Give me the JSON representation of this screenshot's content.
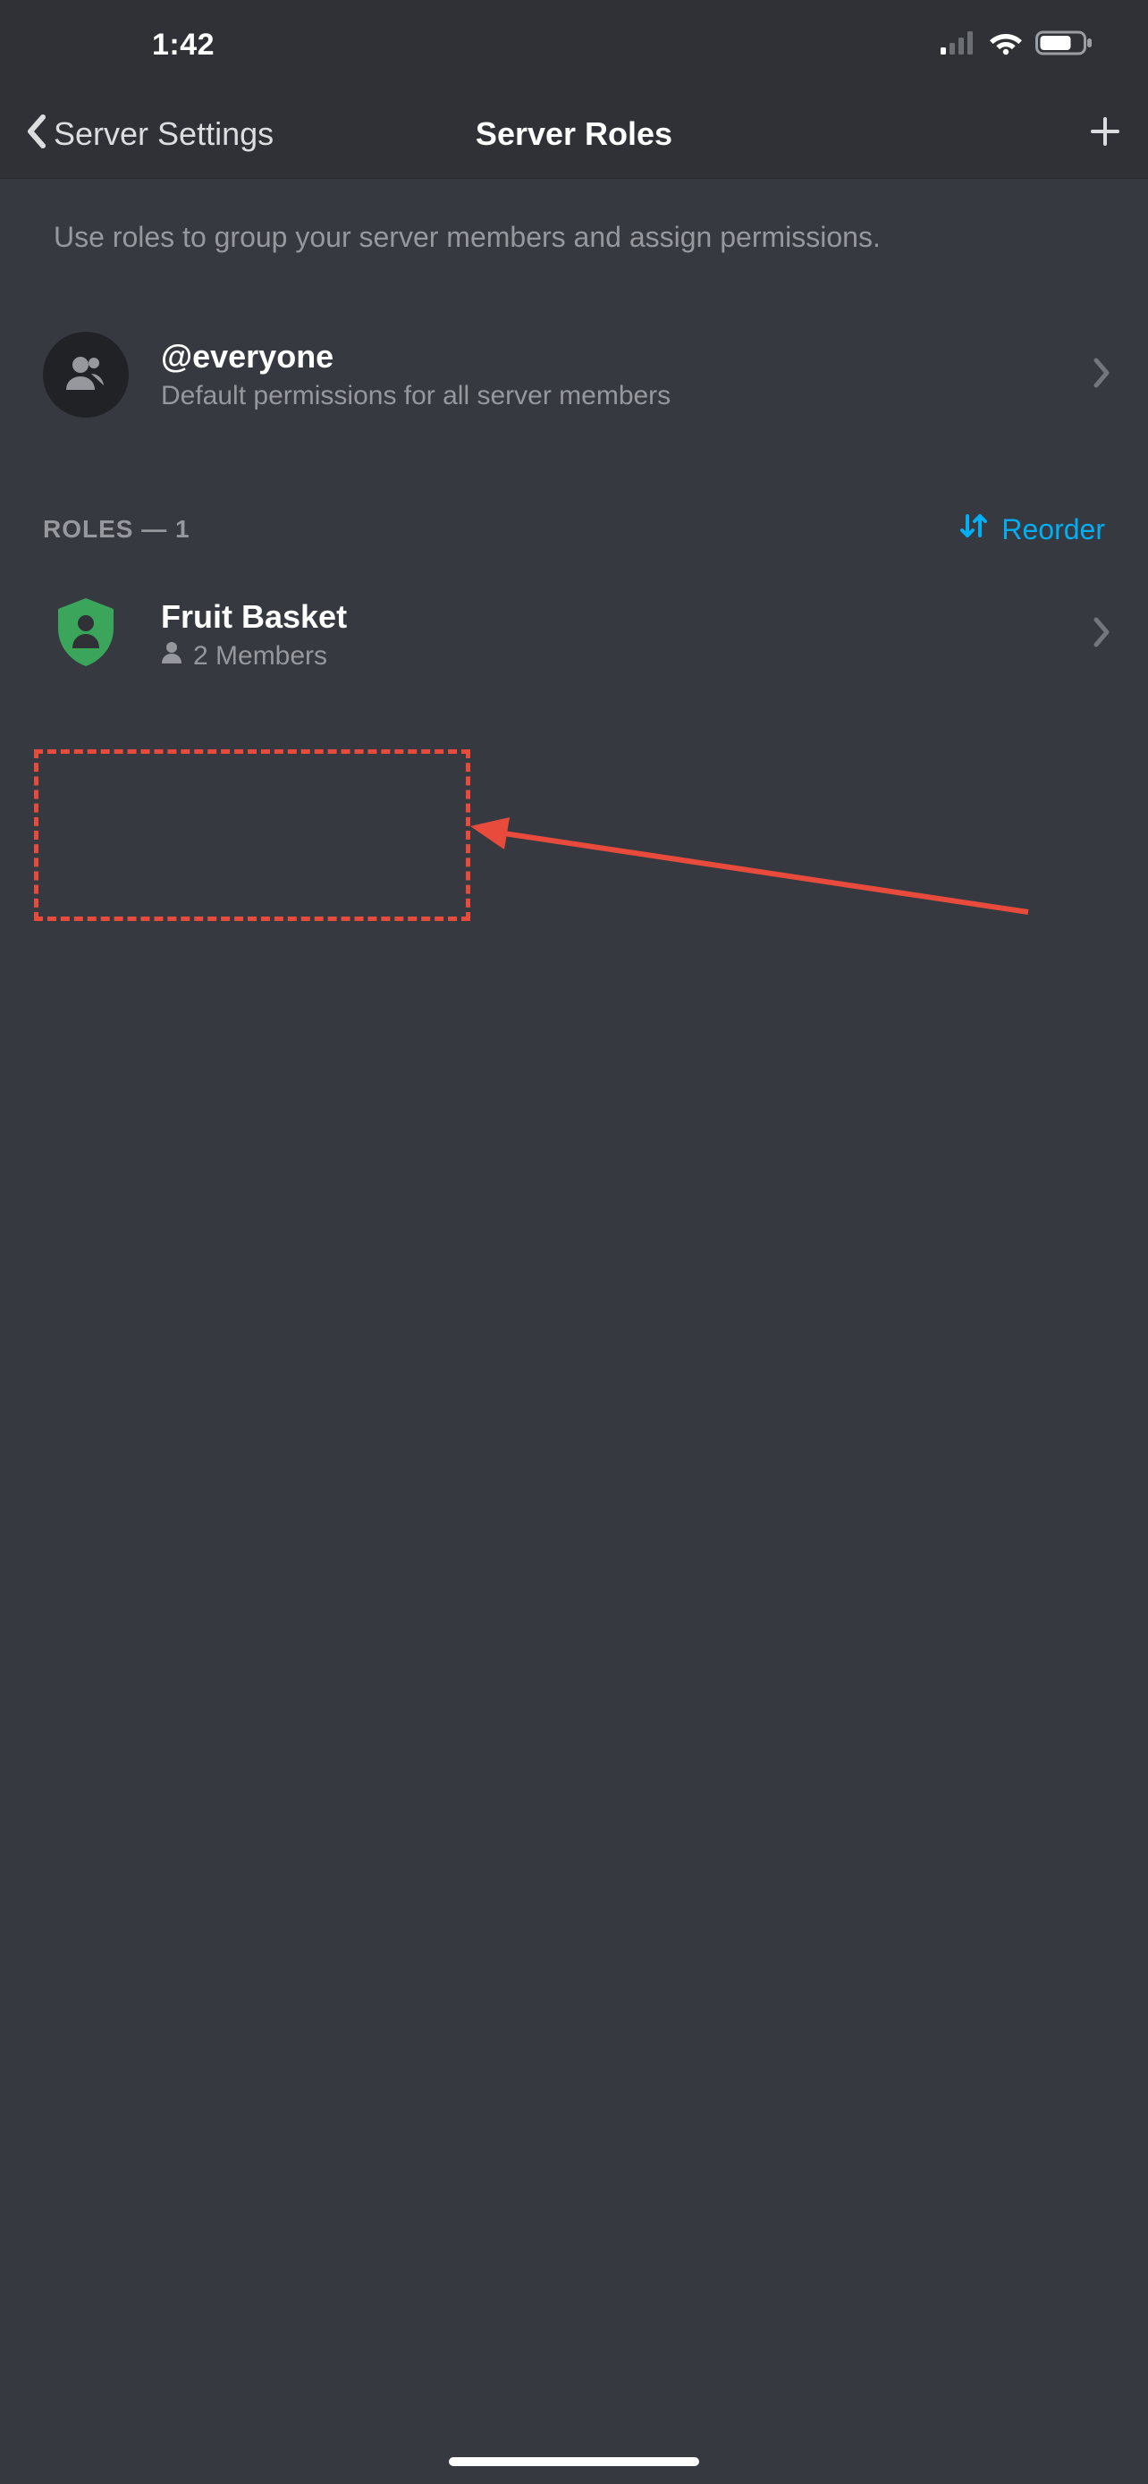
{
  "status": {
    "time": "1:42"
  },
  "nav": {
    "back": "Server Settings",
    "title": "Server Roles"
  },
  "hint": "Use roles to group your server members and assign permissions.",
  "everyone": {
    "title": "@everyone",
    "subtitle": "Default permissions for all server members"
  },
  "section": {
    "label": "ROLES — 1",
    "reorder": "Reorder"
  },
  "roles": [
    {
      "name": "Fruit Basket",
      "members": "2 Members",
      "color": "#3ba55c"
    }
  ]
}
